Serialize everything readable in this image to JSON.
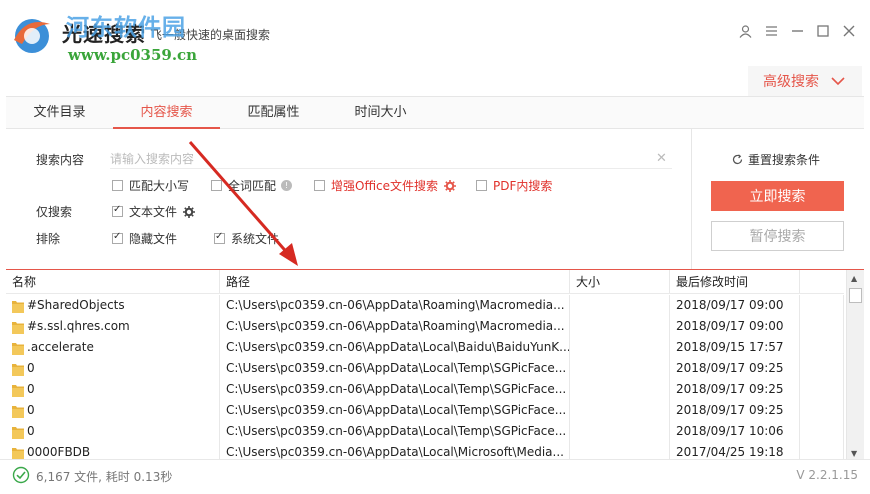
{
  "app": {
    "title": "光速搜索",
    "subtitle": "飞一般快速的桌面搜索",
    "watermark": "河东软件园",
    "watermark_url": "www.pc0359.cn"
  },
  "window_buttons": [
    "user-icon",
    "menu-icon",
    "minimize-icon",
    "maximize-icon",
    "close-icon"
  ],
  "advanced": {
    "label": "高级搜索"
  },
  "tabs": [
    {
      "label": "文件目录",
      "active": false
    },
    {
      "label": "内容搜索",
      "active": true
    },
    {
      "label": "匹配属性",
      "active": false
    },
    {
      "label": "时间大小",
      "active": false
    }
  ],
  "search": {
    "content_label": "搜索内容",
    "placeholder": "请输入搜索内容",
    "value": "",
    "options": {
      "match_case": {
        "label": "匹配大小写",
        "checked": false
      },
      "whole_word": {
        "label": "全词匹配",
        "checked": false
      },
      "office_enhanced": {
        "label": "增强Office文件搜索",
        "checked": false
      },
      "pdf_search": {
        "label": "PDF内搜索",
        "checked": false
      }
    },
    "only_label": "仅搜索",
    "only_text": {
      "label": "文本文件",
      "checked": true
    },
    "exclude_label": "排除",
    "exclude_hidden": {
      "label": "隐藏文件",
      "checked": true
    },
    "exclude_system": {
      "label": "系统文件",
      "checked": true
    },
    "reset_label": "重置搜索条件",
    "search_now": "立即搜索",
    "pause": "暂停搜索"
  },
  "table": {
    "headers": {
      "name": "名称",
      "path": "路径",
      "size": "大小",
      "modified": "最后修改时间"
    },
    "rows": [
      {
        "name": "#SharedObjects",
        "path": "C:\\Users\\pc0359.cn-06\\AppData\\Roaming\\Macromedia...",
        "size": "",
        "modified": "2018/09/17 09:00"
      },
      {
        "name": "#s.ssl.qhres.com",
        "path": "C:\\Users\\pc0359.cn-06\\AppData\\Roaming\\Macromedia...",
        "size": "",
        "modified": "2018/09/17 09:00"
      },
      {
        "name": ".accelerate",
        "path": "C:\\Users\\pc0359.cn-06\\AppData\\Local\\Baidu\\BaiduYunK...",
        "size": "",
        "modified": "2018/09/15 17:57"
      },
      {
        "name": "0",
        "path": "C:\\Users\\pc0359.cn-06\\AppData\\Local\\Temp\\SGPicFace...",
        "size": "",
        "modified": "2018/09/17 09:25"
      },
      {
        "name": "0",
        "path": "C:\\Users\\pc0359.cn-06\\AppData\\Local\\Temp\\SGPicFace...",
        "size": "",
        "modified": "2018/09/17 09:25"
      },
      {
        "name": "0",
        "path": "C:\\Users\\pc0359.cn-06\\AppData\\Local\\Temp\\SGPicFace...",
        "size": "",
        "modified": "2018/09/17 09:25"
      },
      {
        "name": "0",
        "path": "C:\\Users\\pc0359.cn-06\\AppData\\Local\\Temp\\SGPicFace...",
        "size": "",
        "modified": "2018/09/17 10:06"
      },
      {
        "name": "0000FBDB",
        "path": "C:\\Users\\pc0359.cn-06\\AppData\\Local\\Microsoft\\Media...",
        "size": "",
        "modified": "2017/04/25 19:18"
      }
    ]
  },
  "status": {
    "summary": "6,167 文件, 耗时 0.13秒",
    "version": "V 2.2.1.15"
  },
  "colors": {
    "accent": "#e5564a",
    "search_button": "#f0644f",
    "folder": "#e8b33c"
  }
}
